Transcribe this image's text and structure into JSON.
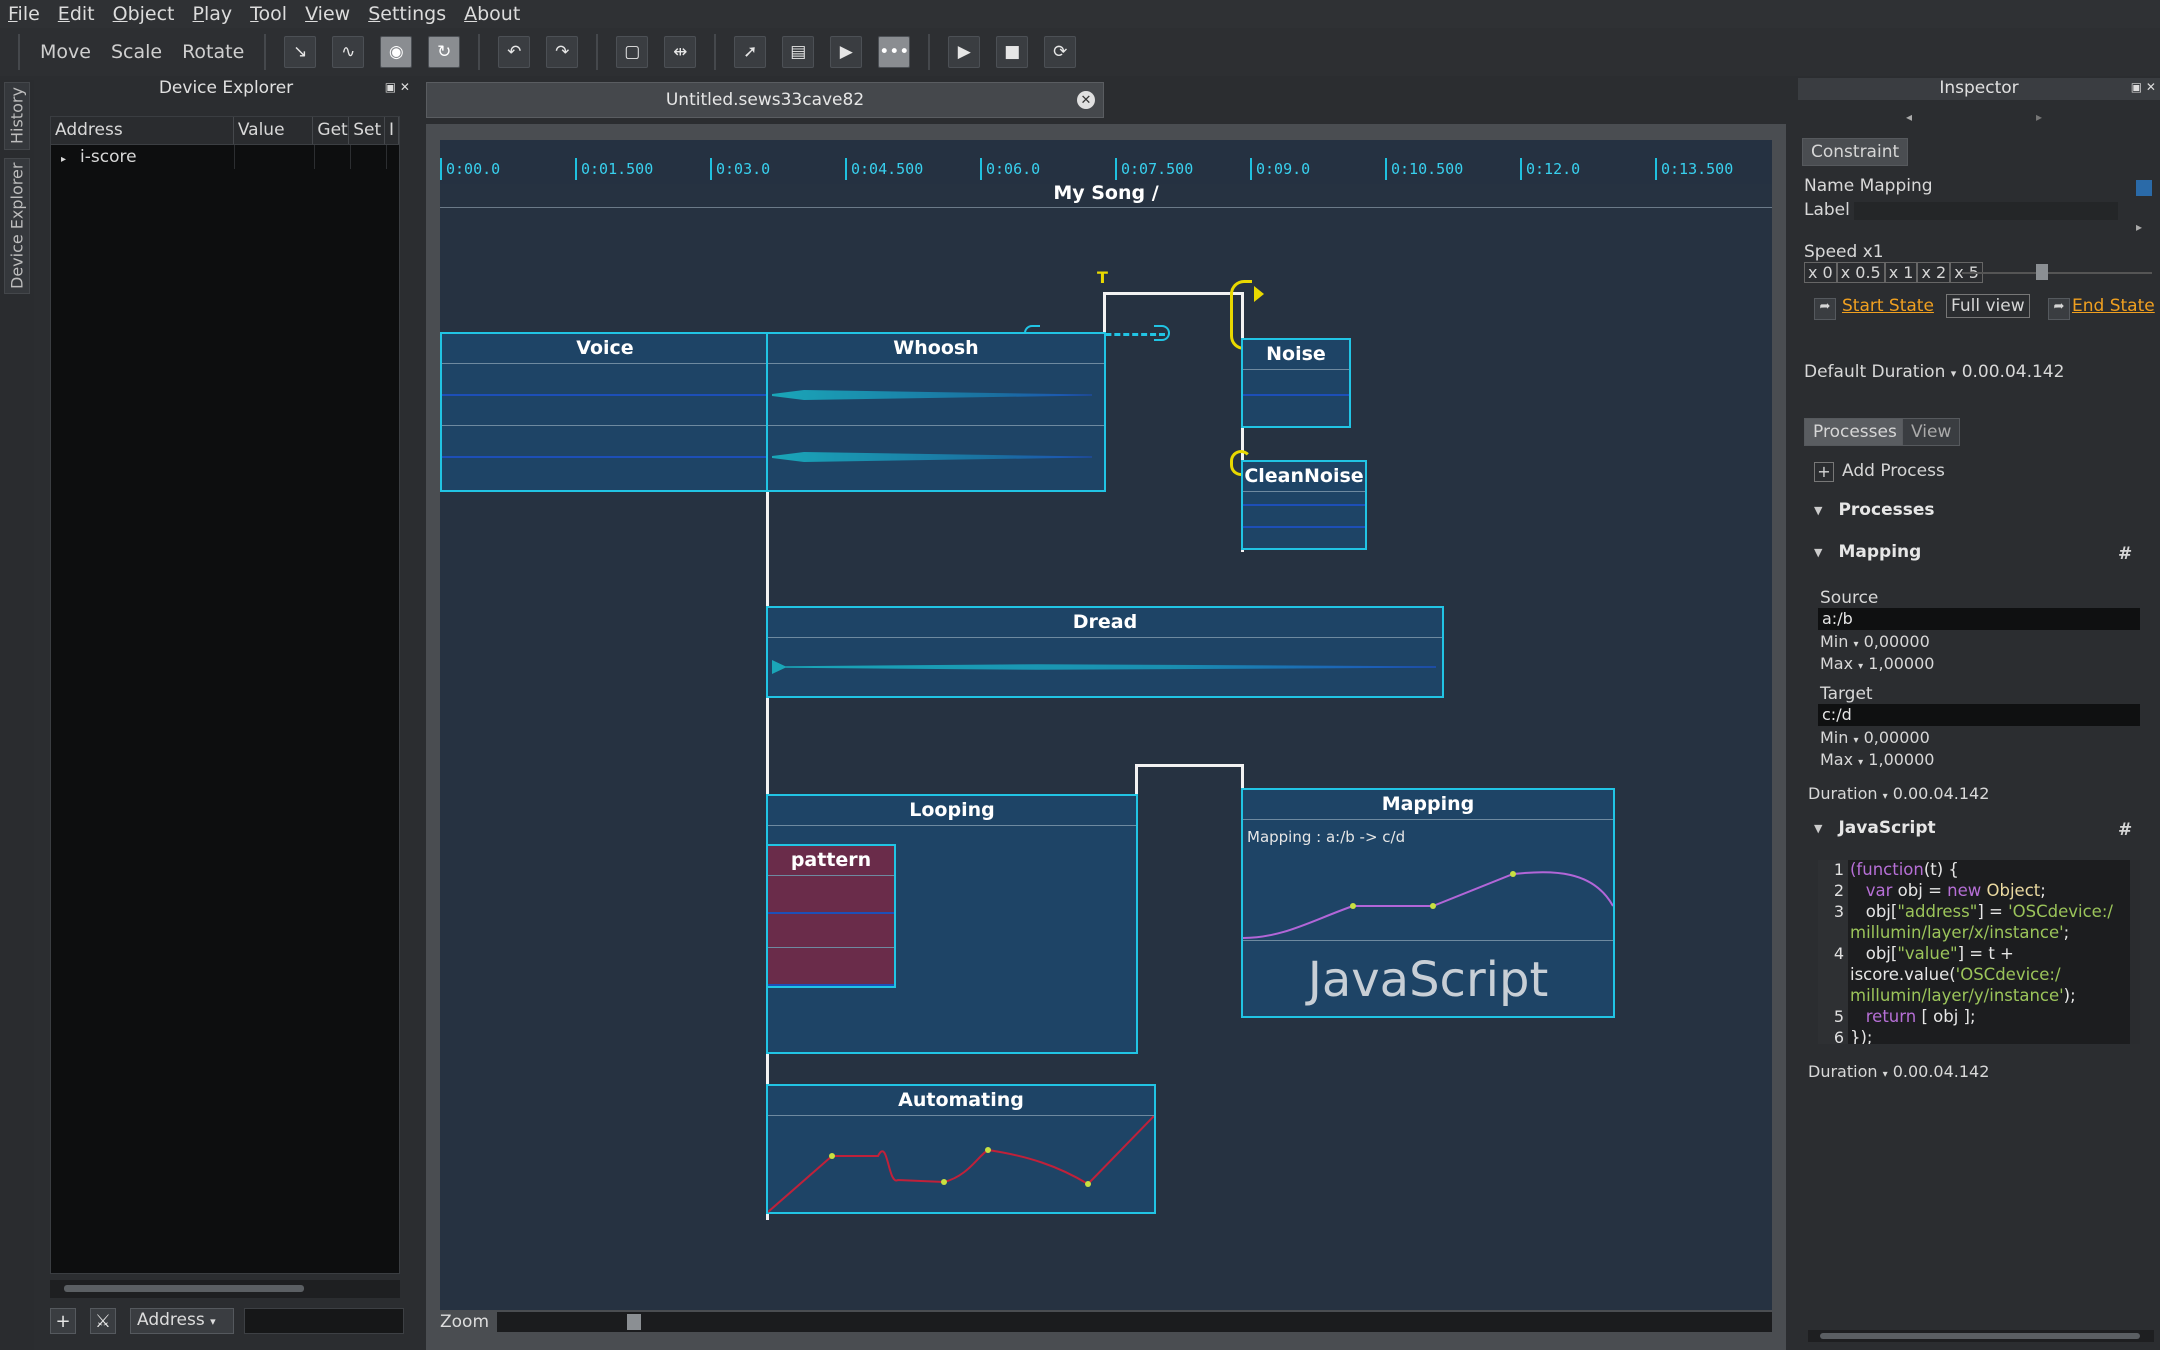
{
  "menu": [
    "File",
    "Edit",
    "Object",
    "Play",
    "Tool",
    "View",
    "Settings",
    "About"
  ],
  "toolbar": {
    "modes": [
      "Move",
      "Scale",
      "Rotate"
    ],
    "icons": [
      "move-point-icon",
      "curve-icon",
      "snapshot-icon",
      "refresh-snapshot-icon",
      "undo-icon",
      "redo-icon",
      "bounding-box-icon",
      "split-icon",
      "select-tool-icon",
      "create-box-icon",
      "play-tool-icon",
      "sequence-tool-icon",
      "play-icon",
      "stop-icon",
      "reinit-icon"
    ]
  },
  "left_tabs": [
    "History",
    "Device Explorer"
  ],
  "device_explorer": {
    "title": "Device Explorer",
    "columns": [
      "Address",
      "Value",
      "Get",
      "Set",
      "I"
    ],
    "rows": [
      {
        "address": "i-score"
      }
    ],
    "address_combo": "Address"
  },
  "document": {
    "tab_title": "Untitled.sews33cave82"
  },
  "timeline": {
    "ticks": [
      "0:00.0",
      "0:01.500",
      "0:03.0",
      "0:04.500",
      "0:06.0",
      "0:07.500",
      "0:09.0",
      "0:10.500",
      "0:12.0",
      "0:13.500"
    ],
    "song_title": "My Song  /"
  },
  "boxes": {
    "voice": "Voice",
    "whoosh": "Whoosh",
    "noise": "Noise",
    "cleannoise": "CleanNoise",
    "dread": "Dread",
    "looping": "Looping",
    "pattern": "pattern",
    "mapping": "Mapping",
    "mapping_caption": "Mapping :   a:/b ->  c/d",
    "javascript_label": "JavaScript",
    "automating": "Automating"
  },
  "zoom_label": "Zoom",
  "inspector": {
    "title": "Inspector",
    "tab": "Constraint",
    "name_label": "Name",
    "name_value": "Mapping",
    "label_label": "Label",
    "speed_label": "Speed x1",
    "speed_options": [
      "x 0",
      "x 0.5",
      "x 1",
      "x 2",
      "x 5"
    ],
    "start_state": "Start State",
    "full_view": "Full view",
    "end_state": "End State",
    "default_duration_label": "Default Duration",
    "default_duration_value": "0.00.04.142",
    "tabs": [
      "Processes",
      "View"
    ],
    "add_process": "Add Process",
    "processes_header": "Processes",
    "mapping_header": "Mapping",
    "hash": "#",
    "source_label": "Source",
    "source_value": "a:/b",
    "source_min_label": "Min",
    "source_min": "0,00000",
    "source_max_label": "Max",
    "source_max": "1,00000",
    "target_label": "Target",
    "target_value": "c:/d",
    "target_min_label": "Min",
    "target_min": "0,00000",
    "target_max_label": "Max",
    "target_max": "1,00000",
    "duration_label": "Duration",
    "duration_value": "0.00.04.142",
    "javascript_header": "JavaScript",
    "js_duration_label": "Duration",
    "js_duration_value": "0.00.04.142",
    "code_line_numbers": [
      "1",
      "2",
      "3",
      "",
      "4",
      "",
      "",
      "5",
      "6"
    ]
  },
  "colors": {
    "accent": "#21c4e4",
    "box_fill": "#1e4466",
    "pattern_fill": "#6a2c4a",
    "automation_curve": "#c0213a",
    "mapping_curve": "#b266d8",
    "link_orange": "#f0a020",
    "trigger_yellow": "#e8d800"
  }
}
